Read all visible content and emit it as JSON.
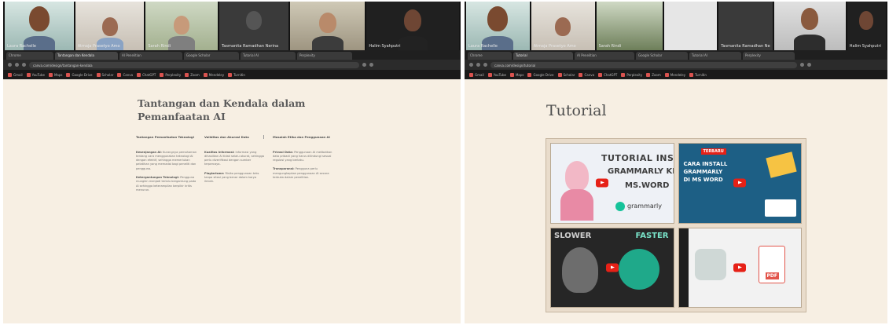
{
  "left_panel": {
    "participants": [
      {
        "name": "Laura Rachelle"
      },
      {
        "name": "Atmaja Prasetyo Amo"
      },
      {
        "name": "Sarah Rindi"
      },
      {
        "name": "Tasmanita Ramadhan Nerina"
      },
      {
        "name": ""
      },
      {
        "name": "Halim Syahputri"
      }
    ],
    "tabs": [
      "Chrome",
      "Tantangan dan Kendala",
      "AI Penelitian",
      "Google Scholar",
      "Tutorial AI",
      "Perplexity"
    ],
    "url": "canva.com/design/tantangan-kendala",
    "bookmarks": [
      "Gmail",
      "YouTube",
      "Maps",
      "Google Drive",
      "Scholar",
      "Canva",
      "ChatGPT",
      "Perplexity",
      "Zoom",
      "Mendeley",
      "Turnitin"
    ],
    "slide": {
      "title": "Tantangan dan Kendala dalam Pemanfaatan AI",
      "columns": [
        {
          "heading": "Tantangan Pemanfaatan Teknologi",
          "paragraphs": [
            {
              "sub": "Kesenjangan AI:",
              "text": "Kurangnya pemahaman tentang cara menggunakan teknologi AI dengan efektif, sehingga memerlukan pelatihan yang memadai bagi peneliti dan pengguna."
            },
            {
              "sub": "Ketergantungan Teknologi:",
              "text": "Pengguna mungkin menjadi terlalu bergantung pada AI sehingga keterampilan berpikir kritis menurun."
            }
          ]
        },
        {
          "heading": "Validitas dan Akurasi Data",
          "paragraphs": [
            {
              "sub": "Kualitas Informasi:",
              "text": "Informasi yang dihasilkan AI tidak selalu akurat, sehingga perlu diverifikasi dengan sumber terpercaya."
            },
            {
              "sub": "Plagiarisme:",
              "text": "Risiko penggunaan teks tanpa sitasi yang benar dalam karya ilmiah."
            }
          ]
        },
        {
          "heading": "Masalah Etika dan Penggunaan AI",
          "paragraphs": [
            {
              "sub": "Privasi Data:",
              "text": "Penggunaan AI melibatkan data pribadi yang harus dilindungi sesuai regulasi yang berlaku."
            },
            {
              "sub": "Transparansi:",
              "text": "Pengguna perlu mengungkapkan penggunaan AI secara terbuka dalam penelitian."
            }
          ]
        }
      ]
    }
  },
  "right_panel": {
    "participants": [
      {
        "name": "Laura Rachelle"
      },
      {
        "name": "Atmaja Prasetyo Amo"
      },
      {
        "name": "Sarah Rindi"
      },
      {
        "name": ""
      },
      {
        "name": "Tasmanita Ramadhan Nerina"
      },
      {
        "name": ""
      },
      {
        "name": "Halim Syahputri"
      }
    ],
    "tabs": [
      "Chrome",
      "Tutorial",
      "AI Penelitian",
      "Google Scholar",
      "Tutorial AI",
      "Perplexity"
    ],
    "url": "canva.com/design/tutorial",
    "bookmarks": [
      "Gmail",
      "YouTube",
      "Maps",
      "Google Drive",
      "Scholar",
      "Canva",
      "ChatGPT",
      "Perplexity",
      "Zoom",
      "Mendeley",
      "Turnitin"
    ],
    "slide": {
      "title": "Tutorial",
      "videos": [
        {
          "line1": "TUTORIAL INSTALL",
          "line2": "GRAMMARLY KE",
          "line3": "MS.WORD",
          "brand": "grammarly"
        },
        {
          "tag": "TERBARU",
          "line1": "CARA INSTALL",
          "line2": "GRAMMARLY",
          "line3": "DI MS WORD"
        },
        {
          "left": "SLOWER",
          "right": "FASTER"
        },
        {
          "label": "PDF"
        }
      ]
    }
  },
  "colors": {
    "slide_bg": "#f7efe3",
    "active_speaker": "#b6e04a",
    "play_red": "#e62117"
  }
}
